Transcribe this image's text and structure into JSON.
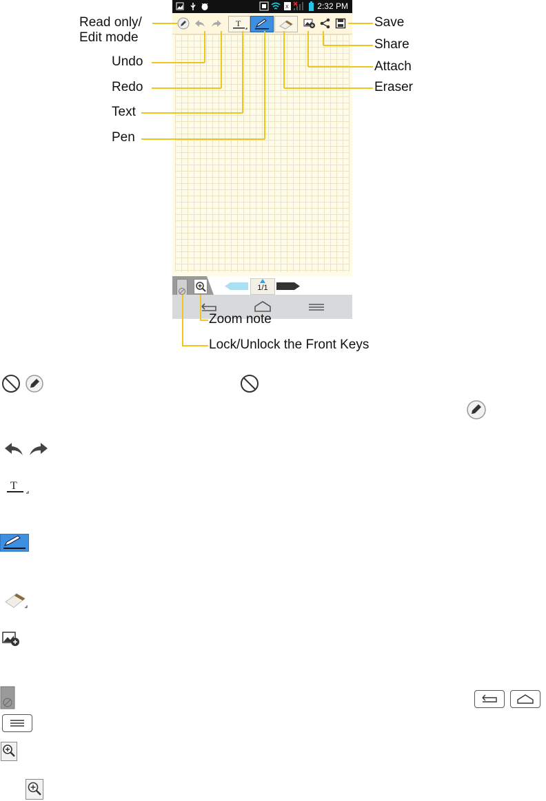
{
  "phone": {
    "status_time": "2:32 PM",
    "page_indicator": "1/1"
  },
  "callouts": {
    "read_only": "Read only/\nEdit mode",
    "undo": "Undo",
    "redo": "Redo",
    "text": "Text",
    "pen": "Pen",
    "save": "Save",
    "share": "Share",
    "attach": "Attach",
    "eraser": "Eraser",
    "zoom_note": "Zoom note",
    "lock_keys": "Lock/Unlock the Front Keys"
  },
  "colors": {
    "callout_line": "#f0c51c",
    "pen_selected": "#3d8fe0",
    "canvas": "#fffbe9"
  }
}
